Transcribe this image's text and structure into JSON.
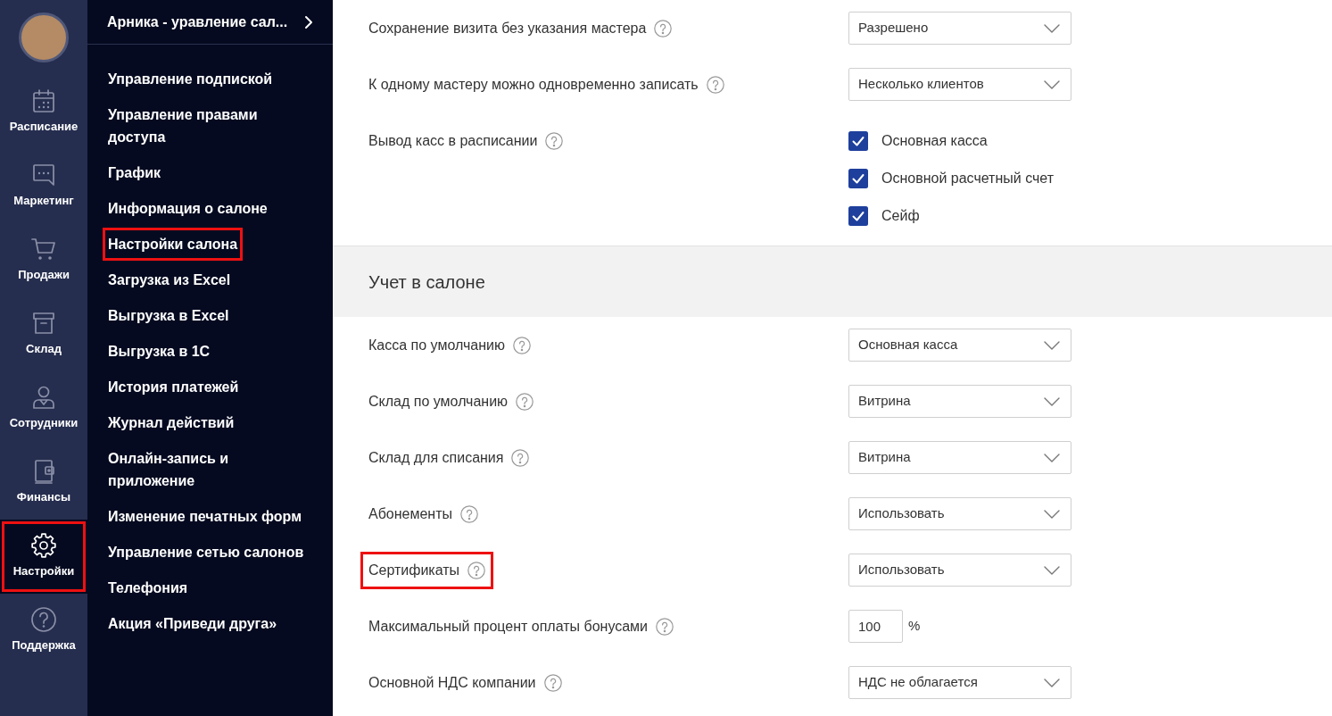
{
  "rail": {
    "items": [
      {
        "label": "Расписание",
        "selected": false,
        "highlighted": false
      },
      {
        "label": "Маркетинг",
        "selected": false,
        "highlighted": false
      },
      {
        "label": "Продажи",
        "selected": false,
        "highlighted": false
      },
      {
        "label": "Склад",
        "selected": false,
        "highlighted": false
      },
      {
        "label": "Сотрудники",
        "selected": false,
        "highlighted": false
      },
      {
        "label": "Финансы",
        "selected": false,
        "highlighted": false
      },
      {
        "label": "Настройки",
        "selected": true,
        "highlighted": true
      },
      {
        "label": "Поддержка",
        "selected": false,
        "highlighted": false
      }
    ]
  },
  "sidebar": {
    "header": "Арника - уравление сал...",
    "items": [
      {
        "label": "Управление подпиской",
        "highlighted": false
      },
      {
        "label": "Управление правами доступа",
        "highlighted": false
      },
      {
        "label": "График",
        "highlighted": false
      },
      {
        "label": "Информация о салоне",
        "highlighted": false
      },
      {
        "label": "Настройки салона",
        "highlighted": true
      },
      {
        "label": "Загрузка из Excel",
        "highlighted": false
      },
      {
        "label": "Выгрузка в Excel",
        "highlighted": false
      },
      {
        "label": "Выгрузка в 1С",
        "highlighted": false
      },
      {
        "label": "История платежей",
        "highlighted": false
      },
      {
        "label": "Журнал действий",
        "highlighted": false
      },
      {
        "label": "Онлайн-запись и приложение",
        "highlighted": false
      },
      {
        "label": "Изменение печатных форм",
        "highlighted": false
      },
      {
        "label": "Управление сетью салонов",
        "highlighted": false
      },
      {
        "label": "Телефония",
        "highlighted": false
      },
      {
        "label": "Акция «Приведи друга»",
        "highlighted": false
      }
    ]
  },
  "settings": {
    "rows": [
      {
        "kind": "select",
        "label": "Сохранение визита без указания мастера",
        "value": "Разрешено",
        "highlighted": false
      },
      {
        "kind": "select",
        "label": "К одному мастеру можно одновременно записать",
        "value": "Несколько клиентов",
        "highlighted": false
      },
      {
        "kind": "checkboxes",
        "label": "Вывод касс в расписании",
        "highlighted": false,
        "options": [
          {
            "label": "Основная касса",
            "checked": true
          },
          {
            "label": "Основной расчетный счет",
            "checked": true
          },
          {
            "label": "Сейф",
            "checked": true
          }
        ]
      }
    ]
  },
  "section": {
    "title": "Учет в салоне",
    "rows": [
      {
        "kind": "select",
        "label": "Касса по умолчанию",
        "value": "Основная касса",
        "highlighted": false
      },
      {
        "kind": "select",
        "label": "Склад по умолчанию",
        "value": "Витрина",
        "highlighted": false
      },
      {
        "kind": "select",
        "label": "Склад для списания",
        "value": "Витрина",
        "highlighted": false
      },
      {
        "kind": "select",
        "label": "Абонементы",
        "value": "Использовать",
        "highlighted": false
      },
      {
        "kind": "select",
        "label": "Сертификаты",
        "value": "Использовать",
        "highlighted": true
      },
      {
        "kind": "number",
        "label": "Максимальный процент оплаты бонусами",
        "value": "100",
        "unit": "%",
        "highlighted": false
      },
      {
        "kind": "select",
        "label": "Основной НДС компании",
        "value": "НДС не облагается",
        "highlighted": false
      }
    ]
  }
}
